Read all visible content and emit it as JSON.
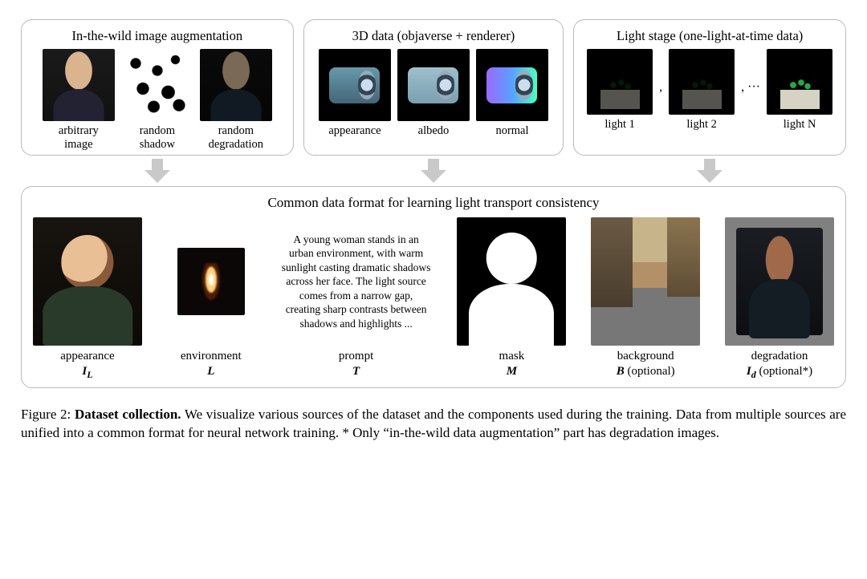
{
  "panels": {
    "wild": {
      "title": "In-the-wild image augmentation",
      "items": [
        {
          "label": "arbitrary\nimage"
        },
        {
          "label": "random\nshadow"
        },
        {
          "label": "random\ndegradation"
        }
      ]
    },
    "objaverse": {
      "title": "3D data (objaverse + renderer)",
      "items": [
        {
          "label": "appearance"
        },
        {
          "label": "albedo"
        },
        {
          "label": "normal"
        }
      ]
    },
    "lightstage": {
      "title": "Light stage (one-light-at-time data)",
      "items": [
        {
          "label": "light 1"
        },
        {
          "label": "light 2"
        },
        {
          "label": "light N"
        }
      ],
      "sep1": ",",
      "sep2": ", ···"
    }
  },
  "common": {
    "title": "Common data format for learning light transport consistency",
    "prompt_text": "A young woman stands in an urban environment, with warm sunlight casting dramatic shadows across her face. The light source comes from a narrow gap, creating sharp contrasts between shadows and highlights ...",
    "items": {
      "appearance": {
        "label": "appearance",
        "sym": "I",
        "sub": "L"
      },
      "environment": {
        "label": "environment",
        "sym": "L"
      },
      "prompt": {
        "label": "prompt",
        "sym": "T"
      },
      "mask": {
        "label": "mask",
        "sym": "M"
      },
      "background": {
        "label": "background",
        "sym": "B",
        "note": "(optional)"
      },
      "degradation": {
        "label": "degradation",
        "sym": "I",
        "sub": "d",
        "note": "(optional*)"
      }
    }
  },
  "caption": {
    "fig": "Figure 2:",
    "title": "Dataset collection.",
    "body": "We visualize various sources of the dataset and the components used during the training. Data from multiple sources are unified into a common format for neural network training. * Only “in-the-wild data augmentation” part has degradation images."
  }
}
